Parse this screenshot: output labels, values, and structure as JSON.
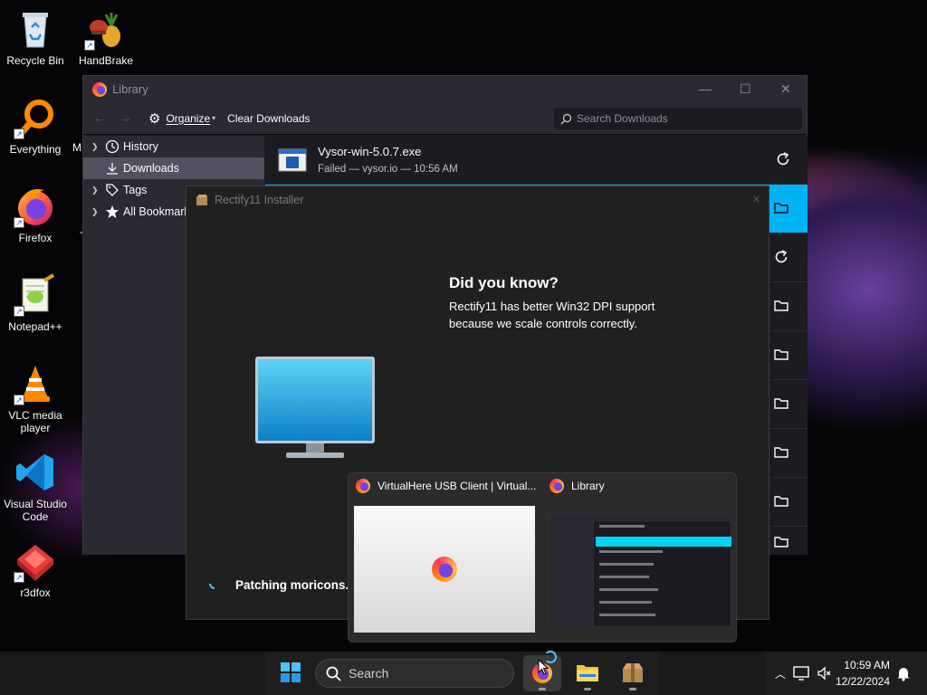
{
  "desktop": {
    "icons": [
      {
        "label": "Recycle Bin",
        "icon": "recycle-bin-icon"
      },
      {
        "label": "HandBrake",
        "icon": "handbrake-icon"
      },
      {
        "label": "Everything",
        "icon": "everything-icon"
      },
      {
        "label": "M",
        "icon": "partial-icon"
      },
      {
        "label": "Firefox",
        "icon": "firefox-icon"
      },
      {
        "label": "T",
        "icon": "partial-icon"
      },
      {
        "label": "Notepad++",
        "icon": "notepadpp-icon"
      },
      {
        "label": "VLC media player",
        "icon": "vlc-icon"
      },
      {
        "label": "Visual Studio Code",
        "icon": "vscode-icon"
      },
      {
        "label": "r3dfox",
        "icon": "r3dfox-icon"
      }
    ]
  },
  "library": {
    "title": "Library",
    "toolbar": {
      "organize": "Organize",
      "clear_downloads": "Clear Downloads",
      "search_placeholder": "Search Downloads"
    },
    "sidebar": [
      {
        "label": "History",
        "icon": "clock-icon"
      },
      {
        "label": "Downloads",
        "icon": "download-icon"
      },
      {
        "label": "Tags",
        "icon": "tag-icon"
      },
      {
        "label": "All Bookmarks",
        "icon": "star-icon"
      }
    ],
    "downloads": [
      {
        "name": "Vysor-win-5.0.7.exe",
        "status": "Failed — vysor.io — 10:56 AM",
        "action": "retry-icon"
      }
    ]
  },
  "rectify": {
    "title": "Rectify11 Installer",
    "tip_heading": "Did you know?",
    "tip_body": "Rectify11 has better Win32 DPI support because we scale controls correctly.",
    "progress_text": "Patching moricons.d"
  },
  "flyout": {
    "tab1": "VirtualHere USB Client | Virtual...",
    "tab2": "Library"
  },
  "taskbar": {
    "search_label": "Search",
    "time": "10:59 AM",
    "date": "12/22/2024"
  }
}
